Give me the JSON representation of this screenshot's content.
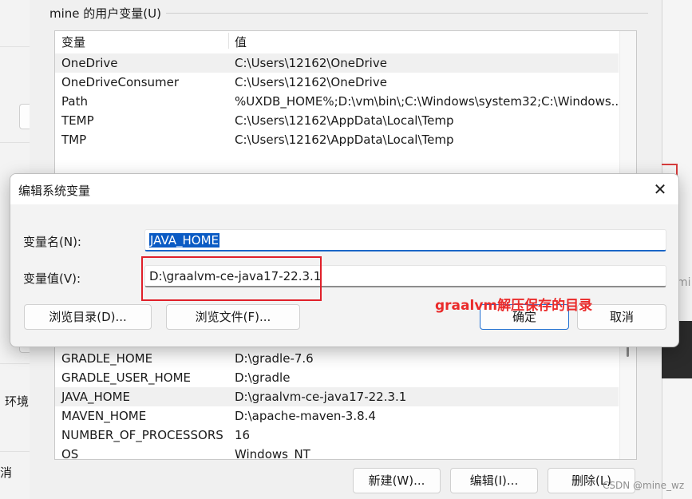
{
  "background_window": {
    "left_label": "环境",
    "left_label_2": "消",
    "right_partial": "mi"
  },
  "user_vars": {
    "group_title": "mine 的用户变量(U)",
    "columns": [
      "变量",
      "值"
    ],
    "rows": [
      {
        "name": "OneDrive",
        "value": "C:\\Users\\12162\\OneDrive"
      },
      {
        "name": "OneDriveConsumer",
        "value": "C:\\Users\\12162\\OneDrive"
      },
      {
        "name": "Path",
        "value": "%UXDB_HOME%;D:\\vm\\bin\\;C:\\Windows\\system32;C:\\Windows..."
      },
      {
        "name": "TEMP",
        "value": "C:\\Users\\12162\\AppData\\Local\\Temp"
      },
      {
        "name": "TMP",
        "value": "C:\\Users\\12162\\AppData\\Local\\Temp"
      }
    ]
  },
  "system_vars": {
    "rows": [
      {
        "name": "GRADLE_HOME",
        "value": "D:\\gradle-7.6"
      },
      {
        "name": "GRADLE_USER_HOME",
        "value": "D:\\gradle"
      },
      {
        "name": "JAVA_HOME",
        "value": "D:\\graalvm-ce-java17-22.3.1"
      },
      {
        "name": "MAVEN_HOME",
        "value": "D:\\apache-maven-3.8.4"
      },
      {
        "name": "NUMBER_OF_PROCESSORS",
        "value": "16"
      },
      {
        "name": "OS",
        "value": "Windows_NT"
      }
    ],
    "buttons": {
      "new": "新建(W)...",
      "edit": "编辑(I)...",
      "delete": "删除(L)"
    }
  },
  "edit_dialog": {
    "title": "编辑系统变量",
    "close_glyph": "✕",
    "name_label": "变量名(N):",
    "name_value": "JAVA_HOME",
    "value_label": "变量值(V):",
    "value_value": "D:\\graalvm-ce-java17-22.3.1",
    "browse_dir": "浏览目录(D)...",
    "browse_file": "浏览文件(F)...",
    "ok": "确定",
    "cancel": "取消"
  },
  "annotation": "graalvm解压保存的目录",
  "watermark": "CSDN @mine_wz",
  "colors": {
    "annotation_red": "#e0202a",
    "selection_blue": "#0b5bc4",
    "primary_border": "#1f6fd1"
  }
}
